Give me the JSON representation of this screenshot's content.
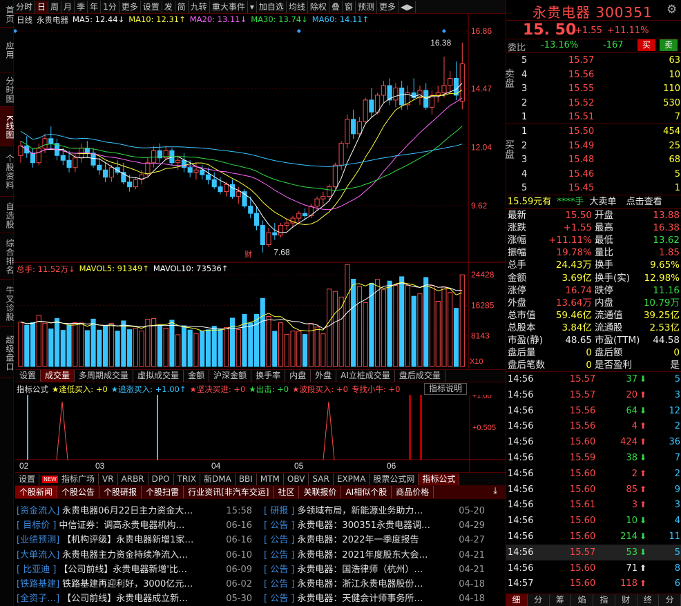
{
  "side_tabs": [
    "首页",
    "应用",
    "分时图",
    "K线图",
    "个股资料",
    "自选股",
    "综合排名",
    "牛叉诊股",
    "超级盘口"
  ],
  "toolbar": [
    "分时",
    "日",
    "周",
    "月",
    "季",
    "年",
    "1分",
    "更多",
    "设置",
    "发",
    "简",
    "九转",
    "重大事件",
    "▾",
    "加自选",
    "均线",
    "除权",
    "叠",
    "窗",
    "预测",
    "更多",
    "◀▶"
  ],
  "chart": {
    "name": "日线",
    "title": "永贵电器",
    "ma": [
      {
        "label": "MA5: 12.44↓",
        "color": "#ffffff"
      },
      {
        "label": "MA10: 12.31↑",
        "color": "#ffff3c"
      },
      {
        "label": "MA20: 13.11↓",
        "color": "#ff66ff"
      },
      {
        "label": "MA30: 13.74↓",
        "color": "#33dd44"
      },
      {
        "label": "MA60: 14.11↑",
        "color": "#38c4ff"
      }
    ],
    "price_ticks": [
      "16.86",
      "14.47",
      "12.04",
      "9.62"
    ],
    "high_label": "16.38",
    "low_label": "7.68",
    "fin_marker": "财",
    "vol_line": [
      {
        "label": "总手: 11.52万↓",
        "color": "#ff4a4a"
      },
      {
        "label": "MAVOL5: 91349↑",
        "color": "#ffff3c"
      },
      {
        "label": "MAVOL10: 73536↑",
        "color": "#ffffff"
      }
    ],
    "vol_ticks": [
      "24428",
      "16285",
      "8143",
      "X10"
    ],
    "months": [
      "02",
      "03",
      "04",
      "05",
      "06"
    ]
  },
  "chart_data": {
    "type": "candlestick",
    "ohlc": [
      [
        11.7,
        12.3,
        11.4,
        12.1
      ],
      [
        12.1,
        12.5,
        11.6,
        11.8
      ],
      [
        11.8,
        12.0,
        11.2,
        11.4
      ],
      [
        11.4,
        12.2,
        11.3,
        12.0
      ],
      [
        12.0,
        12.6,
        11.8,
        12.4
      ],
      [
        12.4,
        12.9,
        12.0,
        12.2
      ],
      [
        12.2,
        12.4,
        11.5,
        11.7
      ],
      [
        11.7,
        12.0,
        11.3,
        11.5
      ],
      [
        11.5,
        11.9,
        11.0,
        11.2
      ],
      [
        11.2,
        11.8,
        11.0,
        11.6
      ],
      [
        11.6,
        12.2,
        11.4,
        12.0
      ],
      [
        12.0,
        12.3,
        11.6,
        11.8
      ],
      [
        11.8,
        12.0,
        11.2,
        11.3
      ],
      [
        11.3,
        11.6,
        10.9,
        11.1
      ],
      [
        11.1,
        11.4,
        10.6,
        10.8
      ],
      [
        10.8,
        11.3,
        10.6,
        11.2
      ],
      [
        11.2,
        11.5,
        10.9,
        11.0
      ],
      [
        11.0,
        11.4,
        10.5,
        10.6
      ],
      [
        10.6,
        10.9,
        10.2,
        10.4
      ],
      [
        10.4,
        10.8,
        10.3,
        10.7
      ],
      [
        10.7,
        11.1,
        10.5,
        10.9
      ],
      [
        10.9,
        11.6,
        10.8,
        11.4
      ],
      [
        11.4,
        12.1,
        11.2,
        11.9
      ],
      [
        11.9,
        12.2,
        11.4,
        11.6
      ],
      [
        11.6,
        12.1,
        11.5,
        11.9
      ],
      [
        11.9,
        12.0,
        11.3,
        11.4
      ],
      [
        11.4,
        11.7,
        11.1,
        11.5
      ],
      [
        11.5,
        11.8,
        11.0,
        11.2
      ],
      [
        11.2,
        11.5,
        10.8,
        11.0
      ],
      [
        11.0,
        11.4,
        10.7,
        11.1
      ],
      [
        11.1,
        11.3,
        10.7,
        10.9
      ],
      [
        10.9,
        11.2,
        10.5,
        10.7
      ],
      [
        10.7,
        11.0,
        10.3,
        10.4
      ],
      [
        10.4,
        10.8,
        10.1,
        10.2
      ],
      [
        10.2,
        10.6,
        10.0,
        10.5
      ],
      [
        10.5,
        10.7,
        9.9,
        10.0
      ],
      [
        10.0,
        10.4,
        9.7,
        10.2
      ],
      [
        10.2,
        10.3,
        9.5,
        9.6
      ],
      [
        9.6,
        10.0,
        9.1,
        9.3
      ],
      [
        9.3,
        9.6,
        8.6,
        8.8
      ],
      [
        8.8,
        9.0,
        7.68,
        8.0
      ],
      [
        8.0,
        8.7,
        7.9,
        8.5
      ],
      [
        8.5,
        8.9,
        8.2,
        8.4
      ],
      [
        8.4,
        8.9,
        8.3,
        8.8
      ],
      [
        8.8,
        9.1,
        8.6,
        8.9
      ],
      [
        8.9,
        9.2,
        8.7,
        9.1
      ],
      [
        9.1,
        9.4,
        8.9,
        9.3
      ],
      [
        9.3,
        9.5,
        9.0,
        9.2
      ],
      [
        9.2,
        9.7,
        9.1,
        9.6
      ],
      [
        9.6,
        10.0,
        9.4,
        9.9
      ],
      [
        9.9,
        10.2,
        9.6,
        10.0
      ],
      [
        10.0,
        10.5,
        9.8,
        10.4
      ],
      [
        10.4,
        11.4,
        10.3,
        11.3
      ],
      [
        11.3,
        12.3,
        11.1,
        12.2
      ],
      [
        12.2,
        13.4,
        12.0,
        13.2
      ],
      [
        13.2,
        13.6,
        12.4,
        12.6
      ],
      [
        12.6,
        13.3,
        12.5,
        13.1
      ],
      [
        13.1,
        14.1,
        13.0,
        14.0
      ],
      [
        14.0,
        14.5,
        13.3,
        13.5
      ],
      [
        13.5,
        14.3,
        13.4,
        14.2
      ],
      [
        14.2,
        14.8,
        13.9,
        14.6
      ],
      [
        14.6,
        14.9,
        13.8,
        14.0
      ],
      [
        14.0,
        14.7,
        13.7,
        14.5
      ],
      [
        14.5,
        14.8,
        13.6,
        13.8
      ],
      [
        13.8,
        14.6,
        13.6,
        14.3
      ],
      [
        14.3,
        14.9,
        14.0,
        14.1
      ],
      [
        14.1,
        14.6,
        13.8,
        14.4
      ],
      [
        14.4,
        14.7,
        13.6,
        13.7
      ],
      [
        13.7,
        14.4,
        13.4,
        14.2
      ],
      [
        14.2,
        14.6,
        13.9,
        14.3
      ],
      [
        14.3,
        15.8,
        14.1,
        14.6
      ],
      [
        14.6,
        15.2,
        14.2,
        14.9
      ],
      [
        14.9,
        15.6,
        14.0,
        14.2
      ],
      [
        13.95,
        16.38,
        13.62,
        15.5
      ]
    ]
  },
  "chart_tabs": [
    "设置",
    "成交量",
    "多周期成交量",
    "虚拟成交量",
    "金额",
    "沪深金额",
    "换手率",
    "内盘",
    "外盘",
    "AI立桩成交量",
    "盘后成交量"
  ],
  "indicator": {
    "name": "指标公式",
    "items": [
      {
        "label": "★逢低买入: +0",
        "color": "#ffff3c"
      },
      {
        "label": "★追涨买入: +1.00↑",
        "color": "#38c4ff"
      },
      {
        "label": "★坚决买进: +0",
        "color": "#ff4a4a"
      },
      {
        "label": "★出击: +0",
        "color": "#33dd44"
      },
      {
        "label": "★波段买入: +0",
        "color": "#ff4a4a"
      },
      {
        "label": "专找小牛: +0",
        "color": "#ff4a4a"
      }
    ],
    "explain": "指标说明",
    "ticks": [
      "+1.00",
      "+0.505"
    ]
  },
  "formula_tabs": [
    "设置",
    "指标广场",
    "VR",
    "ARBR",
    "DPO",
    "TRIX",
    "新DMA",
    "BBI",
    "MTM",
    "OBV",
    "SAR",
    "EXPMA",
    "股票公式网",
    "指标公式"
  ],
  "new_badge": "NEW",
  "news_tabs": [
    "个股新闻",
    "个股公告",
    "个股研报",
    "个股扫雷",
    "行业资讯[非汽车交运]",
    "社区",
    "关联报价",
    "AI相似个股",
    "商品价格"
  ],
  "news_left": [
    {
      "tag": "[资金流入]",
      "title": "永贵电器06月22日主力资金大…",
      "date": "15:58"
    },
    {
      "tag": "[ 目标价 ]",
      "title": "中信证券：调高永贵电器机构…",
      "date": "06-16"
    },
    {
      "tag": "[业绩预测]",
      "title": "【机构评级】永贵电器新增1家…",
      "date": "06-16"
    },
    {
      "tag": "[大单流入]",
      "title": "永贵电器主力资金持续净流入…",
      "date": "06-10"
    },
    {
      "tag": "[ 比亚迪 ]",
      "title": "【公司前线】永贵电器新增'比…",
      "date": "06-09"
    },
    {
      "tag": "[铁路基建]",
      "title": "铁路基建再迎利好，3000亿元…",
      "date": "06-02"
    },
    {
      "tag": "[全资子…]",
      "title": "【公司前线】永贵电器成立新…",
      "date": "05-30"
    }
  ],
  "news_right": [
    {
      "tag": "[ 研报 ]",
      "title": "多领域布局，新能源业务助力…",
      "date": "05-20"
    },
    {
      "tag": "[ 公告 ]",
      "title": "永贵电器：300351永贵电器调…",
      "date": "04-29"
    },
    {
      "tag": "[ 公告 ]",
      "title": "永贵电器：2022年一季度报告",
      "date": "04-27"
    },
    {
      "tag": "[ 公告 ]",
      "title": "永贵电器：2021年度股东大会…",
      "date": "04-21"
    },
    {
      "tag": "[ 公告 ]",
      "title": "永贵电器：国浩律师（杭州）…",
      "date": "04-21"
    },
    {
      "tag": "[ 公告 ]",
      "title": "永贵电器：浙江永贵电器股份…",
      "date": "04-18"
    },
    {
      "tag": "[ 公告 ]",
      "title": "永贵电器：天健会计师事务所…",
      "date": "04-18"
    }
  ],
  "quote": {
    "name": "永贵电器",
    "code": "300351",
    "price": "15. 50",
    "change": "+1.55",
    "pct": "+11.11%",
    "weibi_label": "委比",
    "weibi": "-13.16%",
    "weicha": "-167",
    "buy_btn": "买",
    "sell_btn": "卖",
    "sell_side": "卖盘",
    "buy_side": "买盘",
    "asks": [
      [
        "5",
        "15.57",
        "63"
      ],
      [
        "4",
        "15.56",
        "10"
      ],
      [
        "3",
        "15.55",
        "110"
      ],
      [
        "2",
        "15.52",
        "530"
      ],
      [
        "1",
        "15.51",
        "7"
      ]
    ],
    "bids": [
      [
        "1",
        "15.50",
        "454"
      ],
      [
        "2",
        "15.49",
        "25"
      ],
      [
        "3",
        "15.48",
        "68"
      ],
      [
        "4",
        "15.46",
        "5"
      ],
      [
        "5",
        "15.45",
        "1"
      ]
    ],
    "bigorder": {
      "price": "15.59元有",
      "stars": "****手",
      "label": "大卖单",
      "link": "点击查看"
    },
    "stats": [
      [
        "最新",
        "15.50",
        "red",
        "开盘",
        "13.88",
        "red"
      ],
      [
        "涨跌",
        "+1.55",
        "red",
        "最高",
        "16.38",
        "red"
      ],
      [
        "涨幅",
        "+11.11%",
        "red",
        "最低",
        "13.62",
        "grn"
      ],
      [
        "振幅",
        "19.78%",
        "red",
        "量比",
        "1.85",
        "red"
      ],
      [
        "总手",
        "24.43万",
        "yel",
        "换手",
        "9.65%",
        "yel"
      ],
      [
        "金额",
        "3.69亿",
        "yel",
        "换手(实)",
        "12.98%",
        "yel"
      ],
      [
        "涨停",
        "16.74",
        "red",
        "跌停",
        "11.16",
        "grn"
      ],
      [
        "外盘",
        "13.64万",
        "red",
        "内盘",
        "10.79万",
        "grn"
      ],
      [
        "总市值",
        "59.46亿",
        "yel",
        "流通值",
        "39.25亿",
        "yel"
      ],
      [
        "总股本",
        "3.84亿",
        "yel",
        "流通股",
        "2.53亿",
        "yel"
      ],
      [
        "市盈(静)",
        "48.65",
        "wht",
        "市盈(TTM)",
        "44.58",
        "wht"
      ],
      [
        "盘后量",
        "0",
        "yel",
        "盘后额",
        "0",
        "yel"
      ],
      [
        "盘后笔数",
        "0",
        "yel",
        "是否盈利",
        "是",
        "wht"
      ]
    ],
    "ticks": [
      [
        "14:56",
        "15.57",
        "37",
        "down",
        "5"
      ],
      [
        "14:56",
        "15.57",
        "20",
        "up",
        "3"
      ],
      [
        "14:56",
        "15.56",
        "64",
        "down",
        "12"
      ],
      [
        "14:56",
        "15.56",
        "4",
        "up",
        "2"
      ],
      [
        "14:56",
        "15.60",
        "424",
        "up",
        "36"
      ],
      [
        "14:56",
        "15.59",
        "38",
        "down",
        "7"
      ],
      [
        "14:56",
        "15.60",
        "2",
        "up",
        "2"
      ],
      [
        "14:56",
        "15.60",
        "85",
        "up",
        "9"
      ],
      [
        "14:56",
        "15.61",
        "3",
        "up",
        "3"
      ],
      [
        "14:56",
        "15.60",
        "10",
        "down",
        "4"
      ],
      [
        "14:56",
        "15.60",
        "214",
        "down",
        "11"
      ],
      [
        "14:56",
        "15.57",
        "53",
        "down",
        "5"
      ],
      [
        "14:56",
        "15.60",
        "71",
        "white",
        "8"
      ],
      [
        "14:57",
        "15.60",
        "118",
        "up",
        "6"
      ]
    ]
  },
  "bottom_tabs": [
    "细",
    "分",
    "筹",
    "焰",
    "指",
    "财",
    "终",
    "分"
  ],
  "colors": {
    "up": "#ff4a4a",
    "down": "#33dd44",
    "accent": "#5a0000"
  }
}
